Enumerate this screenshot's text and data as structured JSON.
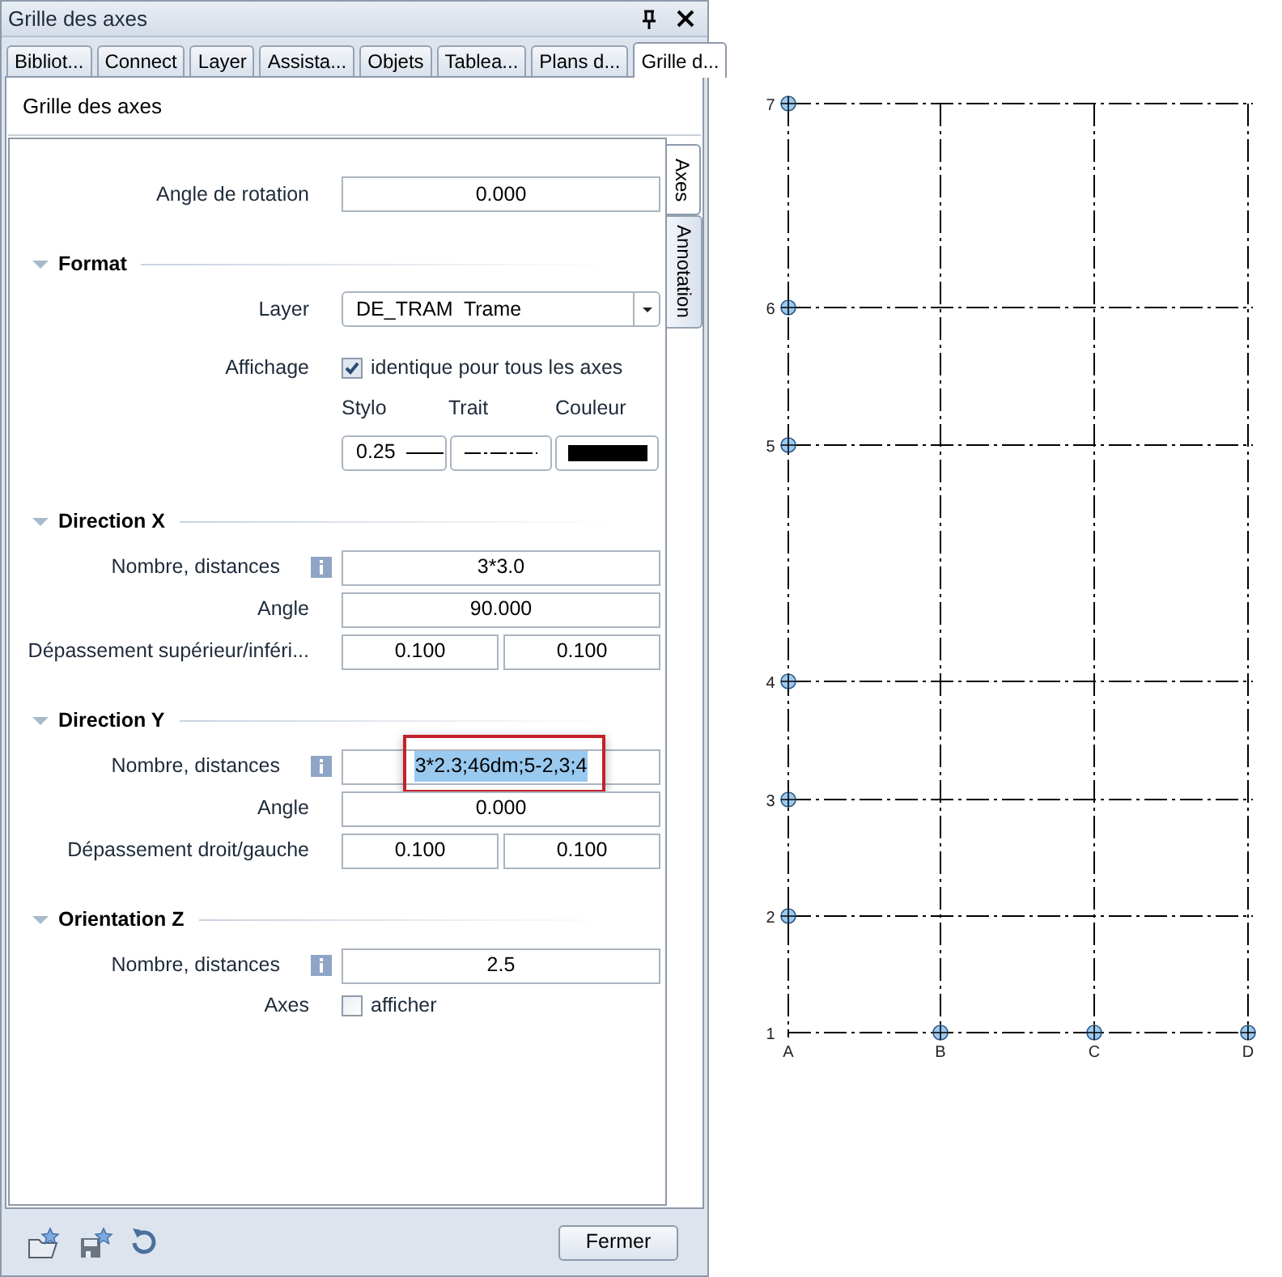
{
  "window": {
    "title": "Grille des axes"
  },
  "tabs": [
    {
      "label": "Bibliot...",
      "selected": false
    },
    {
      "label": "Connect",
      "selected": false
    },
    {
      "label": "Layer",
      "selected": false
    },
    {
      "label": "Assista...",
      "selected": false
    },
    {
      "label": "Objets",
      "selected": false
    },
    {
      "label": "Tablea...",
      "selected": false
    },
    {
      "label": "Plans d...",
      "selected": false
    },
    {
      "label": "Grille d...",
      "selected": true
    }
  ],
  "panel_title": "Grille des axes",
  "side_tabs": [
    {
      "label": "Axes",
      "selected": true
    },
    {
      "label": "Annotation",
      "selected": false
    }
  ],
  "sections": [
    {
      "rows": [
        {
          "kind": "field",
          "label": "Angle de rotation",
          "value": "0.000"
        }
      ]
    },
    {
      "title": "Format",
      "expanded": true,
      "rows": [
        {
          "kind": "dropdown",
          "label": "Layer",
          "value": "DE_TRAM  Trame"
        },
        {
          "kind": "checkbox",
          "label": "Affichage",
          "text": "identique pour tous les axes",
          "checked": true
        },
        {
          "kind": "pen",
          "headers": [
            "Stylo",
            "Trait",
            "Couleur"
          ],
          "pen": "0.25",
          "color": "#000000"
        }
      ]
    },
    {
      "title": "Direction X",
      "expanded": true,
      "rows": [
        {
          "kind": "field",
          "label": "Nombre, distances",
          "info": true,
          "value": "3*3.0"
        },
        {
          "kind": "field",
          "label": "Angle",
          "value": "90.000"
        },
        {
          "kind": "pair",
          "label": "Dépassement supérieur/inféri...",
          "values": [
            "0.100",
            "0.100"
          ]
        }
      ]
    },
    {
      "title": "Direction Y",
      "expanded": true,
      "rows": [
        {
          "kind": "field",
          "label": "Nombre, distances",
          "info": true,
          "value": "3*2.3;46dm;5-2,3;4",
          "highlighted": true
        },
        {
          "kind": "field",
          "label": "Angle",
          "value": "0.000"
        },
        {
          "kind": "pair",
          "label": "Dépassement droit/gauche",
          "values": [
            "0.100",
            "0.100"
          ]
        }
      ]
    },
    {
      "title": "Orientation Z",
      "expanded": true,
      "rows": [
        {
          "kind": "field",
          "label": "Nombre, distances",
          "info": true,
          "value": "2.5"
        },
        {
          "kind": "checkbox",
          "label": "Axes",
          "text": "afficher",
          "checked": false
        }
      ]
    }
  ],
  "footer": {
    "close_button": "Fermer"
  },
  "grid": {
    "x_axes": [
      "A",
      "B",
      "C",
      "D"
    ],
    "y_axes": [
      "7",
      "6",
      "5",
      "4",
      "3",
      "2",
      "1"
    ]
  }
}
